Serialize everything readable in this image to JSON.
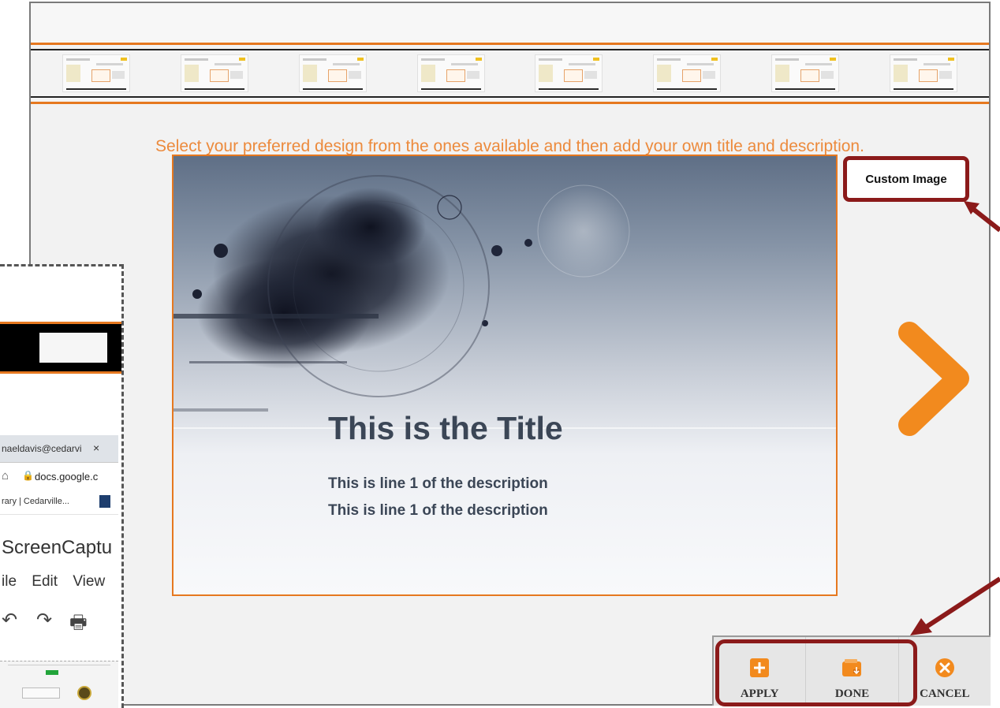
{
  "instruction_text": "Select your preferred design from the ones available and then add your own title and description.",
  "preview": {
    "title": "This is the Title",
    "line1": "This is line 1 of the description",
    "line2": "This is line 1 of the description"
  },
  "custom_image_label": "Custom Image",
  "toolbar": {
    "apply_label": "APPLY",
    "done_label": "DONE",
    "cancel_label": "CANCEL"
  },
  "inset": {
    "tab_text": "naeldavis@cedarvi",
    "tab_close": "×",
    "address": "docs.google.c",
    "bookmark": "rary | Cedarville...",
    "doc_title": "ScreenCaptu",
    "menu": [
      "ile",
      "Edit",
      "View"
    ]
  },
  "colors": {
    "accent": "#e6781f",
    "annotation": "#8b1a1a",
    "title_text": "#3b4656"
  },
  "icons": {
    "apply": "plus-square-icon",
    "done": "wallet-download-icon",
    "cancel": "x-circle-icon",
    "next": "chevron-right-icon"
  }
}
